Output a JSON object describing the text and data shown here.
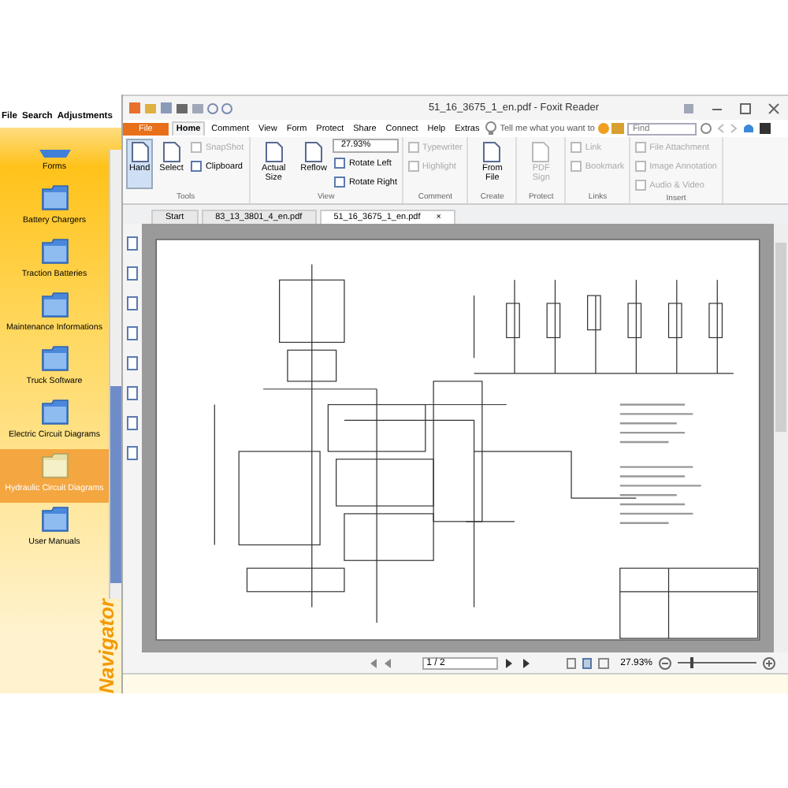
{
  "navigator": {
    "menu": [
      "File",
      "Search",
      "Adjustments"
    ],
    "items": [
      {
        "label": "Forms",
        "selected": false,
        "kind": "cut"
      },
      {
        "label": "Battery Chargers",
        "selected": false,
        "kind": "folder"
      },
      {
        "label": "Traction Batteries",
        "selected": false,
        "kind": "folder"
      },
      {
        "label": "Maintenance Informations",
        "selected": false,
        "kind": "folder"
      },
      {
        "label": "Truck Software",
        "selected": false,
        "kind": "folder"
      },
      {
        "label": "Electric Circuit Diagrams",
        "selected": false,
        "kind": "folder"
      },
      {
        "label": "Hydraulic Circuit Diagrams",
        "selected": true,
        "kind": "folder"
      },
      {
        "label": "User Manuals",
        "selected": false,
        "kind": "folder"
      }
    ],
    "title": "Navigator"
  },
  "reader": {
    "title": "51_16_3675_1_en.pdf - Foxit Reader",
    "ribbon_tabs": [
      {
        "label": "File",
        "selected": false,
        "kind": "file"
      },
      {
        "label": "Home",
        "selected": true,
        "kind": "tab"
      },
      {
        "label": "Comment",
        "selected": false,
        "kind": "tab"
      },
      {
        "label": "View",
        "selected": false,
        "kind": "tab"
      },
      {
        "label": "Form",
        "selected": false,
        "kind": "tab"
      },
      {
        "label": "Protect",
        "selected": false,
        "kind": "tab"
      },
      {
        "label": "Share",
        "selected": false,
        "kind": "tab"
      },
      {
        "label": "Connect",
        "selected": false,
        "kind": "tab"
      },
      {
        "label": "Help",
        "selected": false,
        "kind": "tab"
      },
      {
        "label": "Extras",
        "selected": false,
        "kind": "tab"
      }
    ],
    "tell_me": "Tell me what you want to",
    "find": {
      "placeholder": "Find"
    },
    "groups": [
      {
        "name": "Tools",
        "buttons": [
          {
            "label": "Hand",
            "kind": "large",
            "selected": true,
            "disabled": false
          },
          {
            "label": "Select",
            "kind": "large",
            "selected": false,
            "disabled": false
          },
          {
            "label": "SnapShot",
            "kind": "small",
            "selected": false,
            "disabled": true
          },
          {
            "label": "Clipboard",
            "kind": "small",
            "selected": false,
            "disabled": false
          }
        ]
      },
      {
        "name": "View",
        "buttons": [
          {
            "label": "Actual Size",
            "kind": "large",
            "selected": false,
            "disabled": false
          },
          {
            "label": "Reflow",
            "kind": "large",
            "selected": false,
            "disabled": false
          },
          {
            "label": "27.93%",
            "kind": "zoom"
          },
          {
            "label": "Rotate Left",
            "kind": "small",
            "selected": false,
            "disabled": false
          },
          {
            "label": "Rotate Right",
            "kind": "small",
            "selected": false,
            "disabled": false
          }
        ]
      },
      {
        "name": "Comment",
        "buttons": [
          {
            "label": "Typewriter",
            "kind": "small",
            "selected": false,
            "disabled": true
          },
          {
            "label": "Highlight",
            "kind": "small",
            "selected": false,
            "disabled": true
          }
        ]
      },
      {
        "name": "Create",
        "buttons": [
          {
            "label": "From File",
            "kind": "large",
            "selected": false,
            "disabled": false
          }
        ]
      },
      {
        "name": "Protect",
        "buttons": [
          {
            "label": "PDF Sign",
            "kind": "large",
            "selected": false,
            "disabled": true
          }
        ]
      },
      {
        "name": "Links",
        "buttons": [
          {
            "label": "Link",
            "kind": "small",
            "selected": false,
            "disabled": true
          },
          {
            "label": "Bookmark",
            "kind": "small",
            "selected": false,
            "disabled": true
          }
        ]
      },
      {
        "name": "Insert",
        "buttons": [
          {
            "label": "File Attachment",
            "kind": "small",
            "selected": false,
            "disabled": true
          },
          {
            "label": "Image Annotation",
            "kind": "small",
            "selected": false,
            "disabled": true
          },
          {
            "label": "Audio & Video",
            "kind": "small",
            "selected": false,
            "disabled": true
          }
        ]
      }
    ],
    "doc_tabs": [
      {
        "label": "Start",
        "selected": false,
        "closable": false
      },
      {
        "label": "83_13_3801_4_en.pdf",
        "selected": false,
        "closable": false
      },
      {
        "label": "51_16_3675_1_en.pdf",
        "selected": true,
        "closable": true
      }
    ],
    "close_mark": "×",
    "page": "1 / 2",
    "status_zoom": "27.93%",
    "zoom_slider": {
      "level": 0.15
    }
  }
}
